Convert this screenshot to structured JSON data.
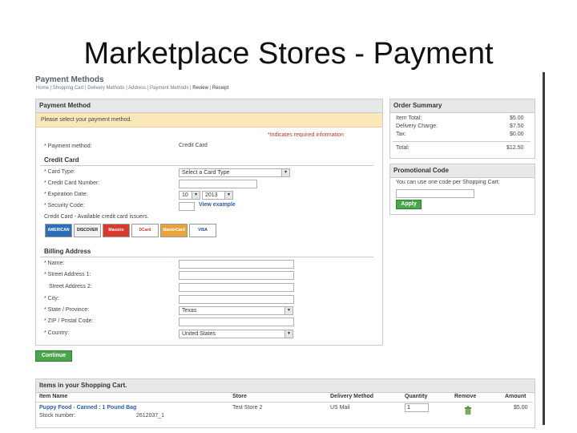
{
  "slide": {
    "title": "Marketplace Stores - Payment"
  },
  "header": {
    "page_title": "Payment Methods",
    "breadcrumb": [
      "Home",
      "Shopping Cart",
      "Delivery Methods",
      "Address",
      "Payment Methods",
      "Review",
      "Receipt"
    ]
  },
  "payment": {
    "panel_title": "Payment Method",
    "notice": "Please select your payment method.",
    "required_note": "*Indicates required information",
    "method_label": "* Payment method:",
    "method_value": "Credit Card",
    "credit_card": {
      "section_title": "Credit Card",
      "card_type_label": "* Card Type:",
      "card_type_value": "Select a Card Type",
      "card_number_label": "* Credit Card Number:",
      "expiration_label": "* Expiration Date:",
      "exp_month": "10",
      "exp_year": "2013",
      "security_label": "* Security Code:",
      "view_example": "View example",
      "issuers_note": "Credit Card - Available credit card issuers.",
      "issuers": [
        "AMERICAN EXPRESS",
        "DISCOVER",
        "Maestro",
        "DCard",
        "MasterCard",
        "VISA"
      ]
    },
    "billing": {
      "section_title": "Billing Address",
      "name_label": "* Name:",
      "street1_label": "* Street Address 1:",
      "street2_label": "Street Address 2:",
      "city_label": "* City:",
      "state_label": "* State / Province:",
      "state_value": "Texas",
      "zip_label": "* ZIP / Postal Code:",
      "country_label": "* Country:",
      "country_value": "United States"
    },
    "continue_label": "Continue"
  },
  "order_summary": {
    "title": "Order Summary",
    "rows": [
      {
        "label": "Item Total:",
        "value": "$5.00"
      },
      {
        "label": "Delivery Charge:",
        "value": "$7.50"
      },
      {
        "label": "Tax:",
        "value": "$0.00"
      }
    ],
    "total_label": "Total:",
    "total_value": "$12.50"
  },
  "promo": {
    "title": "Promotional Code",
    "note": "You can use one code per Shopping Cart.",
    "apply_label": "Apply"
  },
  "cart": {
    "title": "Items in your Shopping Cart.",
    "headers": {
      "item": "Item Name",
      "store": "Store",
      "delivery": "Delivery Method",
      "quantity": "Quantity",
      "remove": "Remove",
      "amount": "Amount"
    },
    "items": [
      {
        "name": "Puppy Food - Canned : 1 Pound Bag",
        "stock_label": "Stock number:",
        "stock_number": "2612037_1",
        "store": "Test Store 2",
        "delivery": "US Mail",
        "quantity": "1",
        "amount": "$5.00"
      }
    ]
  }
}
